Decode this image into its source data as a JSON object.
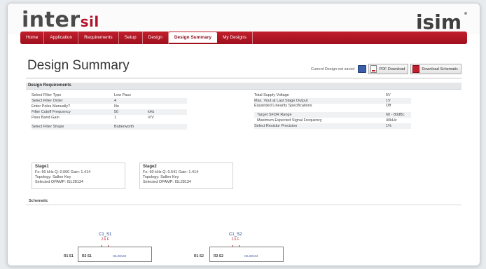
{
  "brand": {
    "logo_main": "inter",
    "logo_sub": "sil",
    "product": "isim"
  },
  "nav": {
    "items": [
      {
        "label": "Home",
        "active": false
      },
      {
        "label": "Application",
        "active": false
      },
      {
        "label": "Requirements",
        "active": false
      },
      {
        "label": "Setup",
        "active": false
      },
      {
        "label": "Design",
        "active": false
      },
      {
        "label": "Design Summary",
        "active": true
      },
      {
        "label": "My Designs",
        "active": false
      }
    ]
  },
  "page": {
    "title": "Design Summary",
    "saved_text": "Current Design not saved",
    "pdf_button": "PDF Download",
    "schematic_button": "Download Schematic"
  },
  "requirements": {
    "header": "Design Requirements",
    "left": [
      {
        "label": "Select Filter Type",
        "value": "Low Pass",
        "unit": ""
      },
      {
        "label": "Select Filter Order",
        "value": "4",
        "unit": ""
      },
      {
        "label": "Enter Poles Manually?",
        "value": "No",
        "unit": ""
      },
      {
        "label": "Filter Cutoff Frequency",
        "value": "50",
        "unit": "kHz"
      },
      {
        "label": "Pass Band Gain",
        "value": "1",
        "unit": "V/V"
      },
      {
        "label": "Select Filter Shape",
        "value": "Butterworth",
        "unit": ""
      }
    ],
    "right": [
      {
        "label": "Total Supply Voltage",
        "value": "5V"
      },
      {
        "label": "Max. Vout at Last Stage Output",
        "value": "1V"
      },
      {
        "label": "Expanded Linearity Specifications",
        "value": "Off"
      },
      {
        "label": "Target SFDR Range",
        "value": "60 - 80dBc"
      },
      {
        "label": "Maximum Expected Signal Frequency",
        "value": "40kHz"
      },
      {
        "label": "Select Resistor Precision",
        "value": "1%"
      }
    ]
  },
  "stages": [
    {
      "title": "Stage1",
      "line1": "Fo: 50 kHz   Q: 0.000   Gain: 1.414",
      "line2": "Topology: Sallen Key",
      "line3": "Selected OPAMP: ISL28134"
    },
    {
      "title": "Stage2",
      "line1": "Fo: 50 kHz   Q: 0.541   Gain: 1.414",
      "line2": "Topology: Sallen Key",
      "line3": "Selected OPAMP: ISL28134"
    }
  ],
  "schematic": {
    "label": "Schematic",
    "parts": [
      {
        "cap": "C1_S1",
        "val": "2.6 F",
        "node_in": "R1 S1",
        "node_out": "R2 S1",
        "link": "ISL28134"
      },
      {
        "cap": "C1_S2",
        "val": "2.6 F",
        "node_in": "R1 S2",
        "node_out": "R2 S2",
        "link": "ISL28134"
      }
    ]
  },
  "colors": {
    "accent": "#b1122a",
    "nav": "#b01826",
    "link": "#1d3f8a"
  }
}
